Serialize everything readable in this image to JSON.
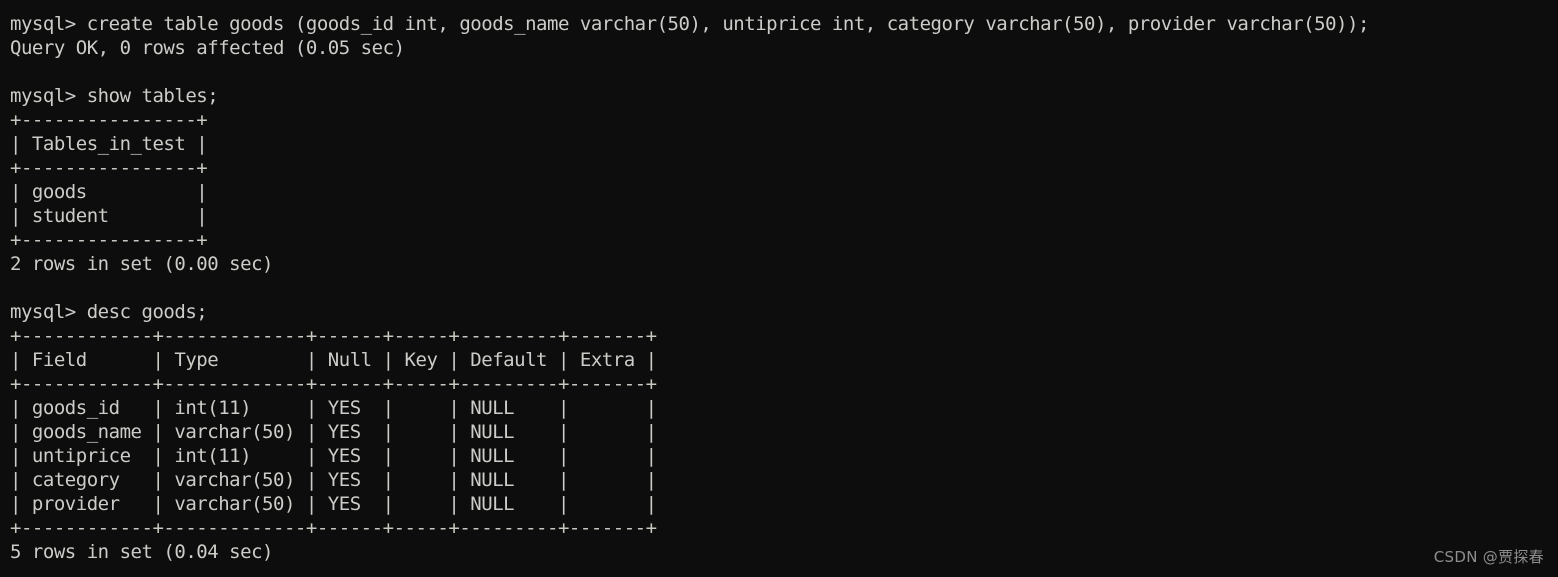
{
  "terminal": {
    "background_color": "#0d0d0d",
    "text_color": "#ccccc8",
    "lines": [
      {
        "kind": "prompt",
        "text": "mysql> create table goods (goods_id int, goods_name varchar(50), untiprice int, category varchar(50), provider varchar(50));"
      },
      {
        "kind": "result",
        "text": "Query OK, 0 rows affected (0.05 sec)"
      },
      {
        "kind": "blank",
        "text": ""
      },
      {
        "kind": "prompt",
        "text": "mysql> show tables;"
      },
      {
        "kind": "rule",
        "text": "+----------------+"
      },
      {
        "kind": "row",
        "text": "| Tables_in_test |"
      },
      {
        "kind": "rule",
        "text": "+----------------+"
      },
      {
        "kind": "row",
        "text": "| goods          |"
      },
      {
        "kind": "row",
        "text": "| student        |"
      },
      {
        "kind": "rule",
        "text": "+----------------+"
      },
      {
        "kind": "result",
        "text": "2 rows in set (0.00 sec)"
      },
      {
        "kind": "blank",
        "text": ""
      },
      {
        "kind": "prompt",
        "text": "mysql> desc goods;"
      },
      {
        "kind": "rule",
        "text": "+------------+-------------+------+-----+---------+-------+"
      },
      {
        "kind": "row",
        "text": "| Field      | Type        | Null | Key | Default | Extra |"
      },
      {
        "kind": "rule",
        "text": "+------------+-------------+------+-----+---------+-------+"
      },
      {
        "kind": "row",
        "text": "| goods_id   | int(11)     | YES  |     | NULL    |       |"
      },
      {
        "kind": "row",
        "text": "| goods_name | varchar(50) | YES  |     | NULL    |       |"
      },
      {
        "kind": "row",
        "text": "| untiprice  | int(11)     | YES  |     | NULL    |       |"
      },
      {
        "kind": "row",
        "text": "| category   | varchar(50) | YES  |     | NULL    |       |"
      },
      {
        "kind": "row",
        "text": "| provider   | varchar(50) | YES  |     | NULL    |       |"
      },
      {
        "kind": "rule",
        "text": "+------------+-------------+------+-----+---------+-------+"
      },
      {
        "kind": "result",
        "text": "5 rows in set (0.04 sec)"
      }
    ],
    "commands": [
      {
        "prompt": "mysql>",
        "sql": "create table goods (goods_id int, goods_name varchar(50), untiprice int, category varchar(50), provider varchar(50));",
        "status": "Query OK, 0 rows affected (0.05 sec)"
      },
      {
        "prompt": "mysql>",
        "sql": "show tables;",
        "status": "2 rows in set (0.00 sec)",
        "table": {
          "headers": [
            "Tables_in_test"
          ],
          "rows": [
            [
              "goods"
            ],
            [
              "student"
            ]
          ]
        }
      },
      {
        "prompt": "mysql>",
        "sql": "desc goods;",
        "status": "5 rows in set (0.04 sec)",
        "table": {
          "headers": [
            "Field",
            "Type",
            "Null",
            "Key",
            "Default",
            "Extra"
          ],
          "rows": [
            [
              "goods_id",
              "int(11)",
              "YES",
              "",
              "NULL",
              ""
            ],
            [
              "goods_name",
              "varchar(50)",
              "YES",
              "",
              "NULL",
              ""
            ],
            [
              "untiprice",
              "int(11)",
              "YES",
              "",
              "NULL",
              ""
            ],
            [
              "category",
              "varchar(50)",
              "YES",
              "",
              "NULL",
              ""
            ],
            [
              "provider",
              "varchar(50)",
              "YES",
              "",
              "NULL",
              ""
            ]
          ]
        }
      }
    ]
  },
  "watermark": {
    "text": "CSDN @贾探春",
    "color": "#8e8e8e"
  }
}
